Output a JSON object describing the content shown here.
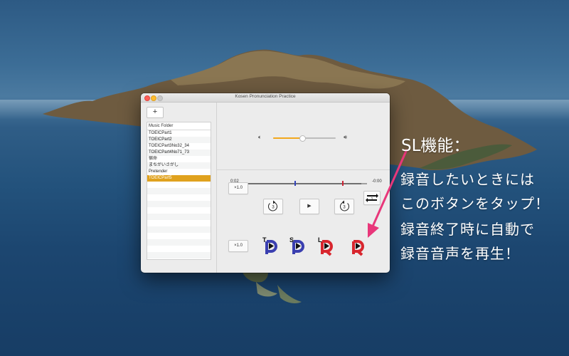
{
  "window": {
    "title": "Kosen Pronunciation Practice"
  },
  "sidebar": {
    "add_label": "+",
    "folder_header": "Music Folder",
    "items": [
      {
        "label": "TOEICPart1"
      },
      {
        "label": "TOEICPart2"
      },
      {
        "label": "TOEICPart3No32_34"
      },
      {
        "label": "TOEICPart4No71_73"
      },
      {
        "label": "宿命"
      },
      {
        "label": "まちがいさがし"
      },
      {
        "label": "Pretender"
      },
      {
        "label": "TOEICPart5"
      }
    ],
    "selected_index": 7
  },
  "volume": {
    "level": 0.45
  },
  "player": {
    "elapsed": "0:02",
    "remaining": "-0:00",
    "progress": 0.95,
    "marker_blue": 0.4,
    "marker_red": 0.8,
    "speed_top": "×1.0",
    "speed_bottom": "×1.0",
    "repeat_count": "1",
    "rewind_seconds": "3",
    "forward_seconds": "3",
    "play_symbol": "▶"
  },
  "sl_buttons": [
    {
      "letter": "T",
      "name": "t-play-button"
    },
    {
      "letter": "S",
      "name": "s-play-button"
    },
    {
      "letter": "L",
      "name": "l-record-button"
    },
    {
      "letter": "",
      "name": "sl-record-button"
    }
  ],
  "annotation": {
    "title": "SL機能：",
    "lines": [
      "録音したいときには",
      "このボタンをタップ！",
      "録音終了時に自動で",
      "録音音声を再生！"
    ]
  },
  "colors": {
    "accent": "#e0a21e",
    "blue_marker": "#3344bb",
    "red_marker": "#cc2233",
    "arrow": "#e8377a",
    "t_s_icon": "#3a3fb0",
    "record_icon": "#d8262e"
  }
}
